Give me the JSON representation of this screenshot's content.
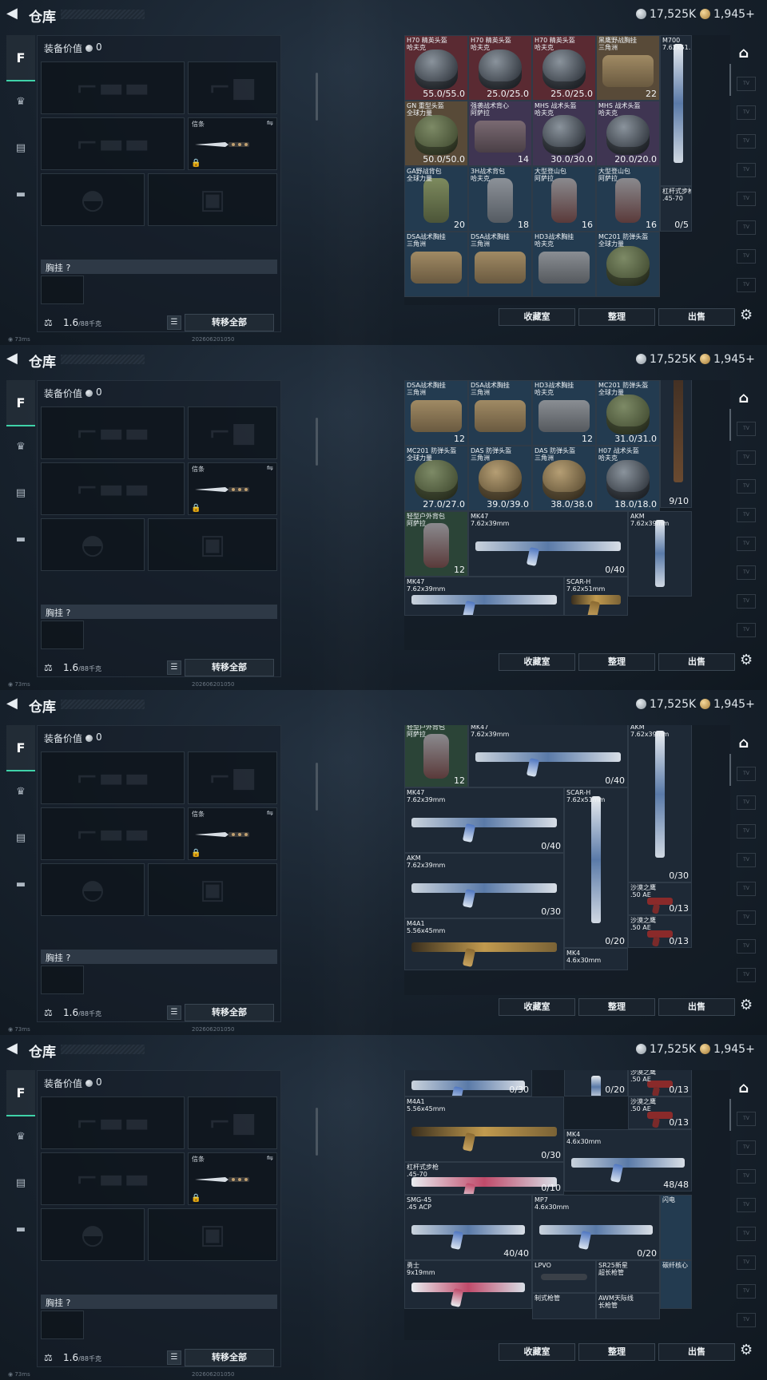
{
  "app": {
    "back_icon": "back-arrow-icon",
    "title": "仓库",
    "silver": "17,525K",
    "gold": "1,945",
    "gold_plus": "+"
  },
  "left_tabs": [
    {
      "icon": "weapon-icon",
      "label": "F"
    },
    {
      "icon": "helmet-icon",
      "label": "♛"
    },
    {
      "icon": "clipboard-icon",
      "label": "▤"
    },
    {
      "icon": "briefcase-icon",
      "label": "▬"
    }
  ],
  "loadout": {
    "value_label": "装备价值",
    "value": "0",
    "melee_label": "信条",
    "vest_label": "胸挂 ?",
    "weight_value": "1.6",
    "weight_unit": "/88千克",
    "transfer_all": "转移全部"
  },
  "status": {
    "ping": "73ms",
    "build": "202606201050"
  },
  "actions": {
    "collection": "收藏室",
    "sort": "整理",
    "sell": "出售"
  },
  "right_tabs": [
    "TV",
    "TV",
    "TV",
    "TV",
    "TV",
    "TV",
    "TV",
    "TV"
  ],
  "panels": [
    {
      "items": [
        {
          "name": "H70 精英头盔\n哈夫克",
          "value": "55.0/55.0",
          "bg": "red",
          "art": "helm"
        },
        {
          "name": "H70 精英头盔\n哈夫克",
          "value": "25.0/25.0",
          "bg": "red",
          "art": "helm"
        },
        {
          "name": "H70 精英头盔\n哈夫克",
          "value": "25.0/25.0",
          "bg": "red",
          "art": "helm"
        },
        {
          "name": "黑鹰野战胸挂\n三角洲",
          "value": "22",
          "bg": "brown",
          "art": "bag"
        },
        {
          "name": "M700\n7.62x51...",
          "value": "",
          "bg": "dark",
          "art": "gunv"
        },
        {
          "name": "GN 重型头盔\n全球力量",
          "value": "50.0/50.0",
          "bg": "brown",
          "art": "helm-olive"
        },
        {
          "name": "强袭战术背心\n阿萨拉",
          "value": "14",
          "bg": "purple",
          "art": "bag-red"
        },
        {
          "name": "MHS 战术头盔\n哈夫克",
          "value": "30.0/30.0",
          "bg": "purple",
          "art": "helm"
        },
        {
          "name": "MHS 战术头盔\n哈夫克",
          "value": "20.0/20.0",
          "bg": "purple",
          "art": "helm"
        },
        {
          "name": "GA野战背包\n全球力量",
          "value": "20",
          "bg": "blue",
          "art": "pack-green"
        },
        {
          "name": "3H战术背包\n哈夫克",
          "value": "18",
          "bg": "blue",
          "art": "pack"
        },
        {
          "name": "大型登山包\n阿萨拉",
          "value": "16",
          "bg": "blue",
          "art": "pack-red"
        },
        {
          "name": "大型登山包\n阿萨拉",
          "value": "16",
          "bg": "blue",
          "art": "pack-red"
        },
        {
          "name": "杠杆式步枪\n.45-70",
          "value": "0/5",
          "bg": "dark",
          "art": "none"
        },
        {
          "name": "DSA战术胸挂\n三角洲",
          "value": "",
          "bg": "blue",
          "art": "bag"
        },
        {
          "name": "DSA战术胸挂\n三角洲",
          "value": "",
          "bg": "blue",
          "art": "bag"
        },
        {
          "name": "HD3战术胸挂\n哈夫克",
          "value": "",
          "bg": "blue",
          "art": "bag-gray"
        },
        {
          "name": "MC201 防弹头盔\n全球力量",
          "value": "",
          "bg": "blue",
          "art": "helm-olive"
        }
      ]
    },
    {
      "items": [
        {
          "name": "",
          "value": "20",
          "bg": "blue",
          "art": "pack-green"
        },
        {
          "name": "",
          "value": "18",
          "bg": "blue",
          "art": "pack"
        },
        {
          "name": "",
          "value": "16",
          "bg": "blue",
          "art": "pack-red"
        },
        {
          "name": "",
          "value": "16",
          "bg": "blue",
          "art": "pack-red"
        },
        {
          "name": "杠杆式步枪\n.45-70",
          "value": "9/10",
          "bg": "dark",
          "art": "gunv-dark"
        },
        {
          "name": "DSA战术胸挂\n三角洲",
          "value": "12",
          "bg": "blue",
          "art": "bag"
        },
        {
          "name": "DSA战术胸挂\n三角洲",
          "value": "",
          "bg": "blue",
          "art": "bag"
        },
        {
          "name": "HD3战术胸挂\n哈夫克",
          "value": "12",
          "bg": "blue",
          "art": "bag-gray"
        },
        {
          "name": "MC201 防弹头盔\n全球力量",
          "value": "31.0/31.0",
          "bg": "blue",
          "art": "helm-olive"
        },
        {
          "name": "MC201 防弹头盔\n全球力量",
          "value": "27.0/27.0",
          "bg": "blue",
          "art": "helm-olive"
        },
        {
          "name": "DAS 防弹头盔\n三角洲",
          "value": "39.0/39.0",
          "bg": "blue",
          "art": "helm-tan"
        },
        {
          "name": "DAS 防弹头盔\n三角洲",
          "value": "38.0/38.0",
          "bg": "blue",
          "art": "helm-tan"
        },
        {
          "name": "H07 战术头盔\n哈夫克",
          "value": "18.0/18.0",
          "bg": "blue",
          "art": "helm"
        },
        {
          "name": "轻型户外背包\n阿萨拉",
          "value": "12",
          "bg": "green",
          "art": "pack-red"
        },
        {
          "name": "MK47\n7.62x39mm",
          "value": "0/40",
          "bg": "dark",
          "art": "gun"
        },
        {
          "name": "AKM\n7.62x39mm",
          "value": "",
          "bg": "dark",
          "art": "gunv"
        },
        {
          "name": "MK47\n7.62x39mm",
          "value": "",
          "bg": "dark",
          "art": "gun"
        },
        {
          "name": "SCAR-H\n7.62x51mm",
          "value": "",
          "bg": "dark",
          "art": "gun-gold"
        }
      ]
    },
    {
      "items": [
        {
          "name": "轻型户外背包\n阿萨拉",
          "value": "12",
          "bg": "green",
          "art": "pack-red"
        },
        {
          "name": "MK47\n7.62x39mm",
          "value": "0/40",
          "bg": "dark",
          "art": "gun"
        },
        {
          "name": "AKM\n7.62x39mm",
          "value": "0/30",
          "bg": "dark",
          "art": "gunv"
        },
        {
          "name": "MK47\n7.62x39mm",
          "value": "0/40",
          "bg": "dark",
          "art": "gun"
        },
        {
          "name": "SCAR-H\n7.62x51mm",
          "value": "0/20",
          "bg": "dark",
          "art": "gunv-gold"
        },
        {
          "name": "AKM\n7.62x39mm",
          "value": "0/30",
          "bg": "dark",
          "art": "gun"
        },
        {
          "name": "沙漠之鹰\n.50 AE",
          "value": "0/13",
          "bg": "dark",
          "art": "pistol"
        },
        {
          "name": "沙漠之鹰\n.50 AE",
          "value": "0/13",
          "bg": "dark",
          "art": "pistol"
        },
        {
          "name": "M4A1\n5.56x45mm",
          "value": "",
          "bg": "dark",
          "art": "gun-gold"
        },
        {
          "name": "MK4\n4.6x30mm",
          "value": "",
          "bg": "dark",
          "art": "none"
        }
      ]
    },
    {
      "items": [
        {
          "name": "",
          "value": "0/30",
          "bg": "dark",
          "art": "gun"
        },
        {
          "name": "",
          "value": "0/20",
          "bg": "dark",
          "art": "gunv-gold"
        },
        {
          "name": "沙漠之鹰\n.50 AE",
          "value": "0/13",
          "bg": "dark",
          "art": "pistol"
        },
        {
          "name": "M4A1\n5.56x45mm",
          "value": "0/30",
          "bg": "dark",
          "art": "gun-gold"
        },
        {
          "name": "沙漠之鹰\n.50 AE",
          "value": "0/13",
          "bg": "dark",
          "art": "pistol"
        },
        {
          "name": "MK4\n4.6x30mm",
          "value": "48/48",
          "bg": "dark",
          "art": "gun"
        },
        {
          "name": "杠杆式步枪\n.45-70",
          "value": "0/10",
          "bg": "dark",
          "art": "gun-red"
        },
        {
          "name": "SMG-45\n.45 ACP",
          "value": "40/40",
          "bg": "dark",
          "art": "gun"
        },
        {
          "name": "MP7\n4.6x30mm",
          "value": "0/20",
          "bg": "dark",
          "art": "gun"
        },
        {
          "name": "闪电",
          "value": "",
          "bg": "blue",
          "art": "none"
        },
        {
          "name": "勇士\n9x19mm",
          "value": "",
          "bg": "dark",
          "art": "gun-red"
        },
        {
          "name": "LPVO",
          "value": "",
          "bg": "dark",
          "art": "scope"
        },
        {
          "name": "SR25新星\n超长枪管",
          "value": "",
          "bg": "dark",
          "art": "none"
        },
        {
          "name": "碳纤核心",
          "value": "",
          "bg": "blue",
          "art": "none"
        },
        {
          "name": "制式枪管",
          "value": "",
          "bg": "dark",
          "art": "none"
        },
        {
          "name": "AWM天际线\n长枪管",
          "value": "",
          "bg": "dark",
          "art": "none"
        }
      ]
    }
  ]
}
